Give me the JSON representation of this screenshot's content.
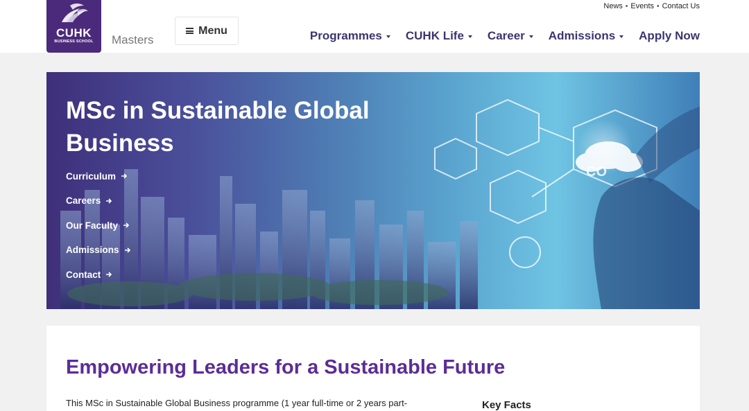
{
  "header": {
    "logo_text": "CUHK",
    "logo_subtext": "BUSINESS SCHOOL",
    "section_label": "Masters",
    "menu_label": "Menu",
    "util_links": [
      "News",
      "Events",
      "Contact Us"
    ],
    "nav": [
      {
        "label": "Programmes",
        "has_dropdown": true
      },
      {
        "label": "CUHK Life",
        "has_dropdown": true
      },
      {
        "label": "Career",
        "has_dropdown": true
      },
      {
        "label": "Admissions",
        "has_dropdown": true
      },
      {
        "label": "Apply Now",
        "has_dropdown": false
      }
    ],
    "brand_color": "#4b2a7b",
    "nav_color": "#3a3570"
  },
  "hero": {
    "title": "MSc in Sustainable Global Business",
    "links": [
      "Curriculum",
      "Careers",
      "Our Faculty",
      "Admissions",
      "Contact"
    ]
  },
  "content": {
    "heading": "Empowering Leaders for a Sustainable Future",
    "body": "This MSc in Sustainable Global Business programme (1 year full-time or 2 years part-",
    "key_facts_label": "Key Facts",
    "heading_color": "#5b2d97"
  }
}
